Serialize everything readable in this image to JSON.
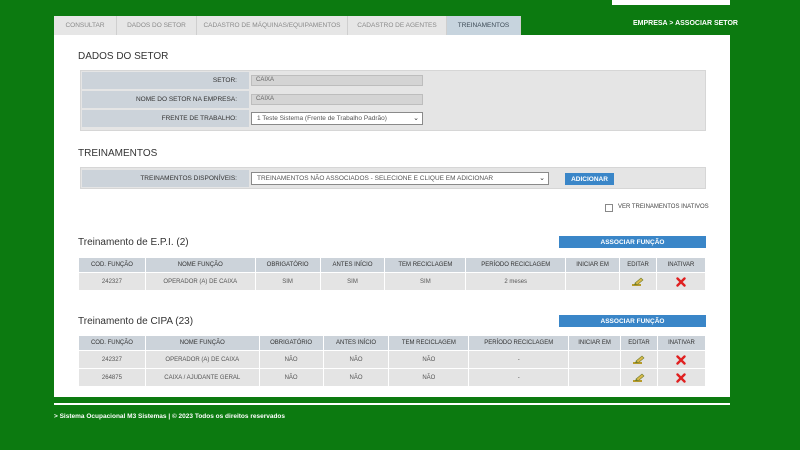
{
  "breadcrumb": "EMPRESA > ASSOCIAR SETOR",
  "tabs": [
    {
      "label": "CONSULTAR"
    },
    {
      "label": "DADOS DO SETOR"
    },
    {
      "label": "CADASTRO DE MÁQUINAS/EQUIPAMENTOS"
    },
    {
      "label": "CADASTRO DE AGENTES"
    },
    {
      "label": "TREINAMENTOS"
    }
  ],
  "dados_setor": {
    "title": "DADOS DO SETOR",
    "setor_label": "SETOR:",
    "setor_value": "CAIXA",
    "nome_label": "NOME DO SETOR NA EMPRESA:",
    "nome_value": "CAIXA",
    "frente_label": "FRENTE DE TRABALHO:",
    "frente_value": "1 Teste Sistema (Frente de Trabalho Padrão)"
  },
  "treinamentos": {
    "title": "TREINAMENTOS",
    "disponiveis_label": "TREINAMENTOS DISPONÍVEIS:",
    "disponiveis_value": "TREINAMENTOS NÃO ASSOCIADOS - SELECIONE E CLIQUE EM ADICIONAR",
    "add_button": "ADICIONAR",
    "inativos_label": "VER TREINAMENTOS INATIVOS"
  },
  "columns": [
    "COD. FUNÇÃO",
    "NOME FUNÇÃO",
    "OBRIGATÓRIO",
    "ANTES INÍCIO",
    "TEM RECICLAGEM",
    "PERÍODO RECICLAGEM",
    "INICIAR EM",
    "EDITAR",
    "INATIVAR"
  ],
  "epi": {
    "title": "Treinamento de E.P.I. (2)",
    "associar_button": "ASSOCIAR FUNÇÃO",
    "rows": [
      {
        "cod": "242327",
        "nome": "OPERADOR (A) DE CAIXA",
        "obrig": "SIM",
        "antes": "SIM",
        "recic": "SIM",
        "periodo": "2 meses",
        "iniciar": ""
      }
    ]
  },
  "cipa": {
    "title": "Treinamento de CIPA (23)",
    "associar_button": "ASSOCIAR FUNÇÃO",
    "rows": [
      {
        "cod": "242327",
        "nome": "OPERADOR (A) DE CAIXA",
        "obrig": "NÃO",
        "antes": "NÃO",
        "recic": "NÃO",
        "periodo": "-",
        "iniciar": ""
      },
      {
        "cod": "264875",
        "nome": "CAIXA / AJUDANTE GERAL",
        "obrig": "NÃO",
        "antes": "NÃO",
        "recic": "NÃO",
        "periodo": "-",
        "iniciar": ""
      }
    ]
  },
  "footer": "> Sistema Ocupacional M3 Sistemas | © 2023 Todos os direitos reservados",
  "icons": {
    "edit": "edit-pencil-icon",
    "inactivate": "red-x-icon",
    "dropdown": "chevron-down-icon"
  },
  "colors": {
    "brand_green": "#0c7a10",
    "accent_blue": "#3a86c8",
    "delete_red": "#e02020"
  }
}
